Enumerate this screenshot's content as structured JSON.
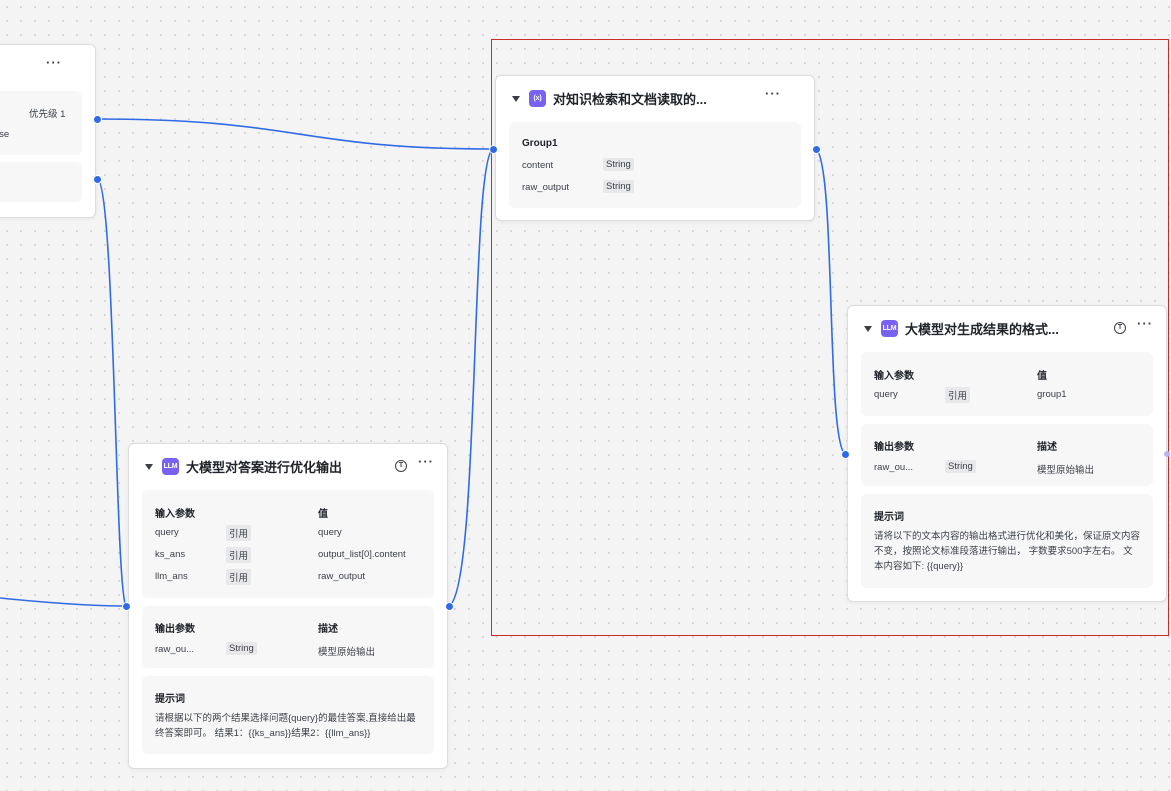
{
  "canvas": {
    "selection_color": "#c92b2b",
    "edge_color": "#2f6be6",
    "llm_badge_color": "#7a62f0"
  },
  "nodes": {
    "condition": {
      "more_icon": "···",
      "priority": "优先级 1",
      "text_fragment": "lse"
    },
    "aggregator": {
      "badge": "(x)",
      "title": "对知识检索和文档读取的...",
      "more_icon": "···",
      "group_title": "Group1",
      "vars": [
        {
          "name": "content",
          "type": "String"
        },
        {
          "name": "raw_output",
          "type": "String"
        }
      ]
    },
    "llm_optimize": {
      "badge": "LLM",
      "title": "大模型对答案进行优化输出",
      "t_icon": "T",
      "more_icon": "···",
      "input_header": "输入参数",
      "value_header": "值",
      "inputs": [
        {
          "name": "query",
          "mode": "引用",
          "value": "query"
        },
        {
          "name": "ks_ans",
          "mode": "引用",
          "value": "output_list[0].content"
        },
        {
          "name": "llm_ans",
          "mode": "引用",
          "value": "raw_output"
        }
      ],
      "output_header": "输出参数",
      "desc_header": "描述",
      "outputs": [
        {
          "name": "raw_ou...",
          "type": "String",
          "desc": "模型原始输出"
        }
      ],
      "prompt_header": "提示词",
      "prompt_text": "请根据以下的两个结果选择问题{query}的最佳答案,直接给出最终答案即可。 结果1：{{ks_ans}}结果2：{{llm_ans}}"
    },
    "llm_format": {
      "badge": "LLM",
      "title": "大模型对生成结果的格式...",
      "t_icon": "T",
      "more_icon": "···",
      "input_header": "输入参数",
      "value_header": "值",
      "inputs": [
        {
          "name": "query",
          "mode": "引用",
          "value": "group1"
        }
      ],
      "output_header": "输出参数",
      "desc_header": "描述",
      "outputs": [
        {
          "name": "raw_ou...",
          "type": "String",
          "desc": "模型原始输出"
        }
      ],
      "prompt_header": "提示词",
      "prompt_text": "请将以下的文本内容的输出格式进行优化和美化，保证原文内容不变，按照论文标准段落进行输出， 字数要求500字左右。 文本内容如下: {{query}}"
    }
  }
}
